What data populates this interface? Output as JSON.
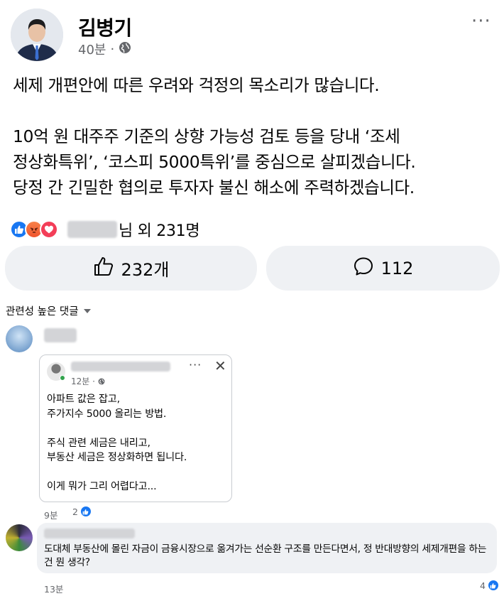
{
  "post": {
    "author": "김병기",
    "time": "40분",
    "separator": "·",
    "more": "···",
    "body": [
      "세제 개편안에 따른 우려와 걱정의 목소리가 많습니다.",
      "",
      "10억 원 대주주 기준의 상향 가능성 검토 등을 당내 ‘조세",
      "정상화특위’, ‘코스피 5000특위’를 중심으로 살피겠습니다.",
      "당정 간 긴밀한 협의로 투자자 불신 해소에 주력하겠습니다."
    ]
  },
  "reactions": {
    "summary": "님 외 231명",
    "icons": [
      "like-icon",
      "angry-icon",
      "love-icon"
    ]
  },
  "actions": {
    "like_count": "232개",
    "comment_count": "112"
  },
  "comments_sort": {
    "label": "관련성 높은 댓글"
  },
  "comments": [
    {
      "shared_card": {
        "time": "12분",
        "separator": "·",
        "more": "···",
        "close": "✕",
        "lines": [
          "아파트 값은 잡고,",
          "주가지수 5000 올리는 방법.",
          "",
          "주식 관련 세금은 내리고,",
          "부동산 세금은 정상화하면 됩니다.",
          "",
          "이게 뭐가 그리 어렵다고..."
        ]
      },
      "time": "9분",
      "likes": "2"
    },
    {
      "text": "도대체 부동산에 몰린 자금이 금융시장으로 옮겨가는 선순환 구조를 만든다면서, 정 반대방향의 세제개편을 하는 건 뭔 생각?",
      "time": "13분",
      "likes": "4"
    }
  ],
  "colors": {
    "accent": "#1877f2",
    "secondary_text": "#65676b",
    "button_bg": "#eff1f4",
    "love": "#f33e58",
    "angry": "#f0542d"
  }
}
